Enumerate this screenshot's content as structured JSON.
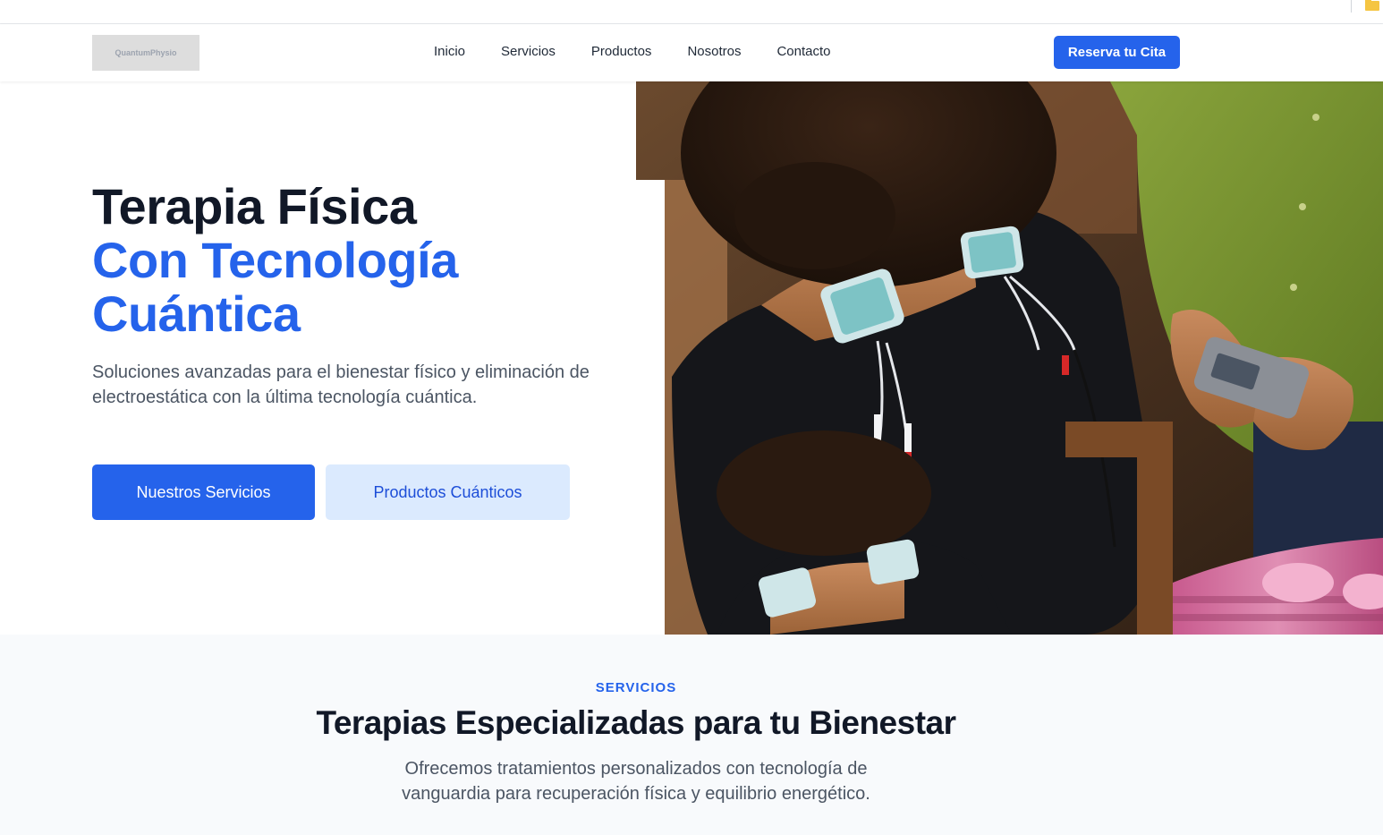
{
  "header": {
    "logo_text": "QuantumPhysio",
    "nav": [
      "Inicio",
      "Servicios",
      "Productos",
      "Nosotros",
      "Contacto"
    ],
    "cta_label": "Reserva tu Cita"
  },
  "hero": {
    "title_line1": "Terapia Física",
    "title_line2": "Con Tecnología",
    "title_line3": "Cuántica",
    "description": "Soluciones avanzadas para el bienestar físico y eliminación de electroestática con la última tecnología cuántica.",
    "primary_button": "Nuestros Servicios",
    "secondary_button": "Productos Cuánticos"
  },
  "services": {
    "eyebrow": "SERVICIOS",
    "title": "Terapias Especializadas para tu Bienestar",
    "description": "Ofrecemos tratamientos personalizados con tecnología de vanguardia para recuperación física y equilibrio energético."
  },
  "colors": {
    "accent": "#2563eb",
    "accent_light": "#dbeafe",
    "heading": "#111827",
    "body_text": "#4b5563",
    "section_bg": "#f8fafc"
  }
}
